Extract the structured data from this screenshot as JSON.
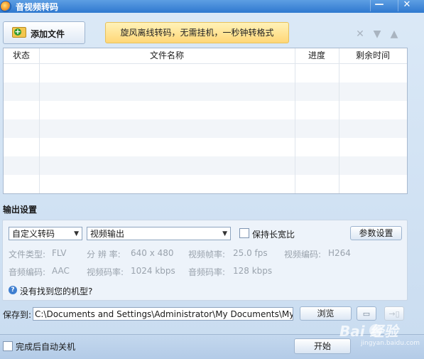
{
  "window": {
    "title": "音视频转码",
    "minimize": "—",
    "close": "✕"
  },
  "toolbar": {
    "add_file_label": "添加文件",
    "promo_text": "旋风离线转码，无需挂机，一秒钟转格式"
  },
  "table": {
    "columns": [
      "状态",
      "文件名称",
      "进度",
      "剩余时间"
    ]
  },
  "output": {
    "section_title": "输出设置",
    "profile_select": "自定义转码",
    "device_select": "视频输出",
    "keep_ratio_label": "保持长宽比",
    "keep_ratio_checked": false,
    "settings_button": "参数设置",
    "info_row1": [
      {
        "label": "文件类型:",
        "value": "FLV"
      },
      {
        "label": "分 辨 率:",
        "value": "640 x 480"
      },
      {
        "label": "视频帧率:",
        "value": "25.0 fps"
      },
      {
        "label": "视频编码:",
        "value": "H264"
      }
    ],
    "info_row2": [
      {
        "label": "音频编码:",
        "value": "AAC"
      },
      {
        "label": "视频码率:",
        "value": "1024 kbps"
      },
      {
        "label": "音频码率:",
        "value": "128 kbps"
      }
    ],
    "help_link": "没有找到您的机型?"
  },
  "save": {
    "label": "保存到:",
    "path": "C:\\Documents and Settings\\Administrator\\My Documents\\My Vide",
    "browse_button": "浏览"
  },
  "footer": {
    "shutdown_label": "完成后自动关机",
    "shutdown_checked": false,
    "start_button": "开始"
  },
  "watermark": {
    "brand": "Bai  经验",
    "sub": "jingyan.baidu.com"
  }
}
